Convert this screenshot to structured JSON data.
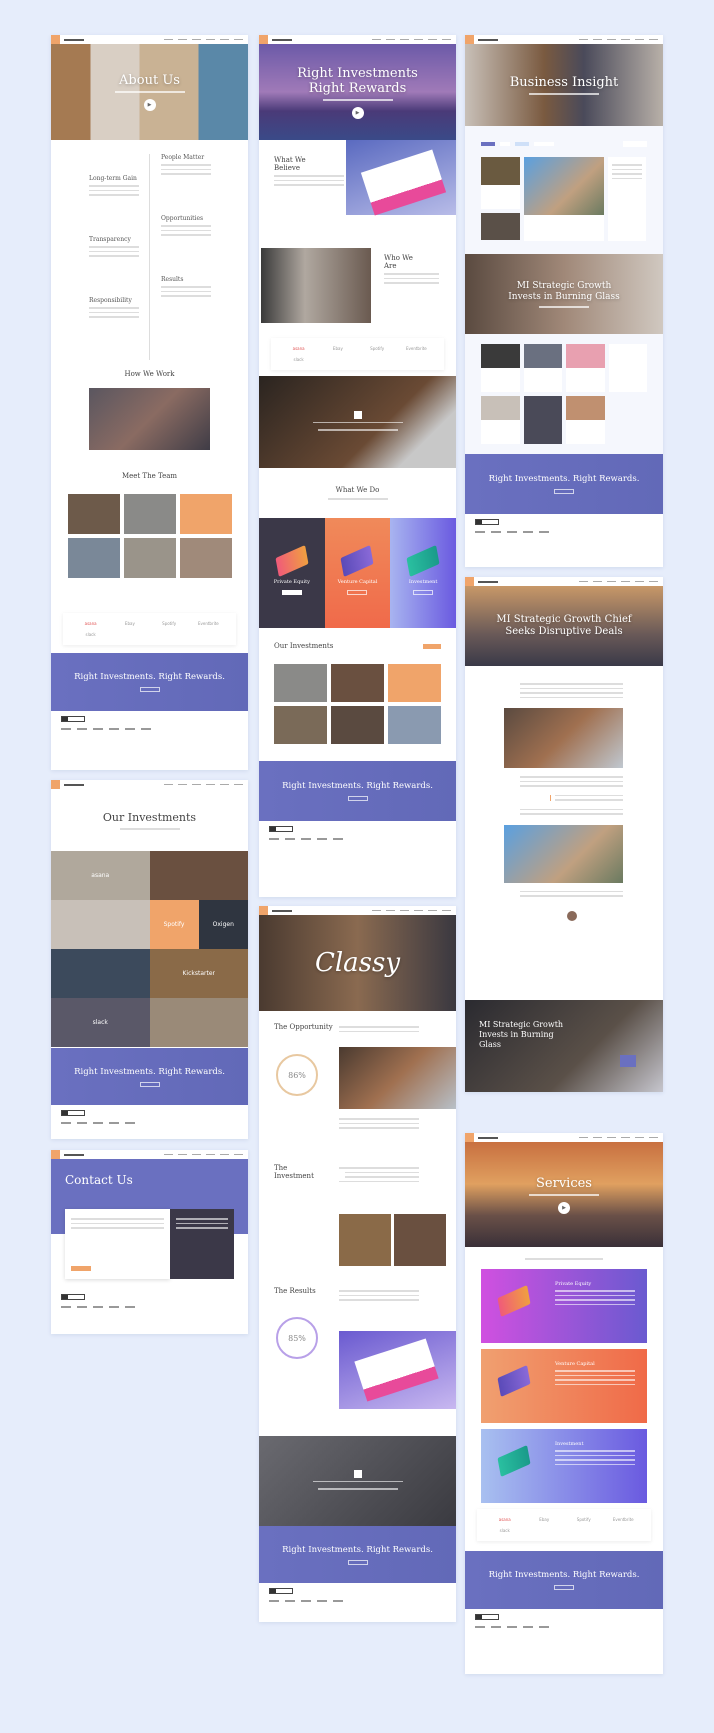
{
  "colors": {
    "background": "#e6edfb",
    "accent": "#f0a46a",
    "purple": "#6a70c0",
    "dark": "#3b3848"
  },
  "about": {
    "hero_title": "About Us",
    "timeline_left": [
      "Long-term Gain",
      "Transparency",
      "Responsibility"
    ],
    "timeline_right": [
      "People Matter",
      "Opportunities",
      "Results"
    ],
    "how_we_work": "How We Work",
    "meet_team": "Meet The Team"
  },
  "logos": [
    "asana",
    "Ebay",
    "Spotify",
    "Eventbrite",
    "slack",
    "",
    "",
    "",
    "",
    ""
  ],
  "cta": {
    "title": "Right Investments. Right Rewards."
  },
  "home": {
    "hero_title_1": "Right Investments",
    "hero_title_2": "Right Rewards",
    "what_we_believe": "What We Believe",
    "who_we_are": "Who We Are",
    "what_we_do": "What We Do",
    "cards": [
      "Private Equity",
      "Venture Capital",
      "Investment"
    ],
    "our_investments": "Our Investments"
  },
  "insight": {
    "hero_title": "Business Insight",
    "banner_title": "MI Strategic Growth Invests in Burning Glass"
  },
  "investments_page": {
    "title": "Our Investments",
    "logos": [
      "asana",
      "Spotify",
      "Oxigen",
      "Kickstarter",
      "slack"
    ]
  },
  "contact": {
    "title": "Contact Us"
  },
  "classy": {
    "hero_title": "Classy",
    "opportunity": "The Opportunity",
    "opportunity_percent": "86%",
    "investment": "The Investment",
    "results": "The Results",
    "results_percent": "85%"
  },
  "article": {
    "hero_title": "MI Strategic Growth Chief Seeks Disruptive Deals",
    "banner_title": "MI Strategic Growth Invests in Burning Glass"
  },
  "services": {
    "hero_title": "Services",
    "cards": [
      "Private Equity",
      "Venture Capital",
      "Investment"
    ]
  }
}
